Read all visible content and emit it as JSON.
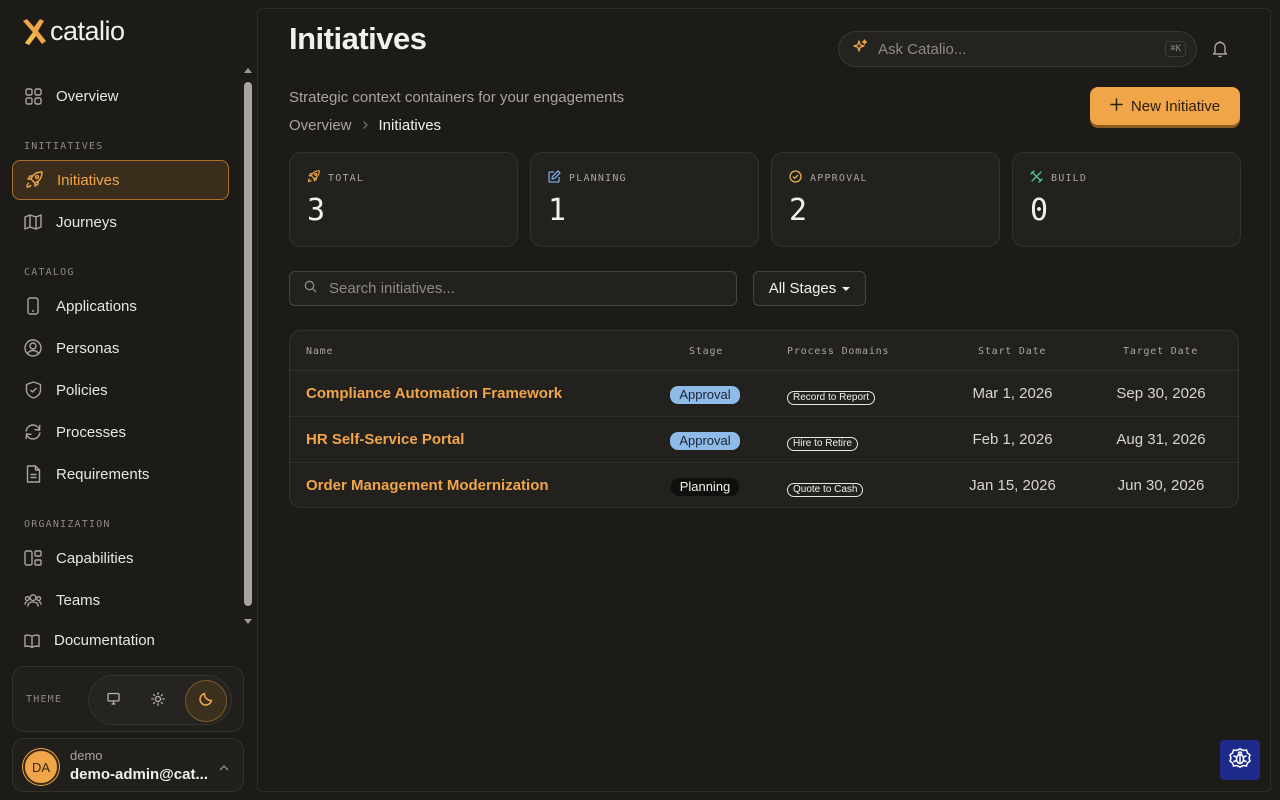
{
  "brand": {
    "name": "catalio",
    "accent": "#f0a548"
  },
  "sidebar": {
    "overview_label": "Overview",
    "sections": {
      "initiatives": "INITIATIVES",
      "catalog": "CATALOG",
      "organization": "ORGANIZATION"
    },
    "items": {
      "initiatives": "Initiatives",
      "journeys": "Journeys",
      "applications": "Applications",
      "personas": "Personas",
      "policies": "Policies",
      "processes": "Processes",
      "requirements": "Requirements",
      "capabilities": "Capabilities",
      "teams": "Teams"
    },
    "documentation": "Documentation",
    "theme": {
      "label": "THEME",
      "selected": "dark"
    },
    "user": {
      "initials": "DA",
      "name": "demo",
      "email": "demo-admin@cat..."
    }
  },
  "header": {
    "title": "Initiatives",
    "ask_placeholder": "Ask Catalio...",
    "ask_shortcut": "⌘K",
    "subtitle": "Strategic context containers for your engagements",
    "breadcrumb": [
      "Overview",
      "Initiatives"
    ],
    "new_button": "New Initiative"
  },
  "stats": [
    {
      "label": "TOTAL",
      "value": "3",
      "icon": "rocket-icon",
      "color": "#f0a548"
    },
    {
      "label": "PLANNING",
      "value": "1",
      "icon": "edit-icon",
      "color": "#7aa6e6"
    },
    {
      "label": "APPROVAL",
      "value": "2",
      "icon": "check-circle-icon",
      "color": "#e2b04a"
    },
    {
      "label": "BUILD",
      "value": "0",
      "icon": "tools-icon",
      "color": "#4fc29b"
    }
  ],
  "filters": {
    "search_placeholder": "Search initiatives...",
    "stage_select": "All Stages"
  },
  "table": {
    "columns": [
      "Name",
      "Stage",
      "Process Domains",
      "Start Date",
      "Target Date"
    ],
    "rows": [
      {
        "name": "Compliance Automation Framework",
        "stage": "Approval",
        "domain": "Record to Report",
        "start": "Mar 1, 2026",
        "target": "Sep 30, 2026"
      },
      {
        "name": "HR Self-Service Portal",
        "stage": "Approval",
        "domain": "Hire to Retire",
        "start": "Feb 1, 2026",
        "target": "Aug 31, 2026"
      },
      {
        "name": "Order Management Modernization",
        "stage": "Planning",
        "domain": "Quote to Cash",
        "start": "Jan 15, 2026",
        "target": "Jun 30, 2026"
      }
    ]
  }
}
